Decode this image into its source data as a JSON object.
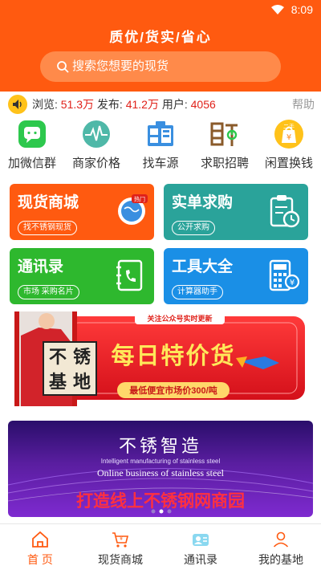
{
  "status": {
    "time": "8:09"
  },
  "header": {
    "slogan": "质优/货实/省心",
    "search_placeholder": "搜索您想要的现货"
  },
  "stats": {
    "browse_label": "浏览:",
    "browse_value": "51.3万",
    "publish_label": "发布:",
    "publish_value": "41.2万",
    "users_label": "用户:",
    "users_value": "4056",
    "help_label": "帮助"
  },
  "quick": [
    {
      "label": "加微信群",
      "icon": "wechat-icon"
    },
    {
      "label": "商家价格",
      "icon": "pulse-icon"
    },
    {
      "label": "找车源",
      "icon": "truck-pin-icon"
    },
    {
      "label": "求职招聘",
      "icon": "recruit-icon"
    },
    {
      "label": "闲置换钱",
      "icon": "secondhand-bag-icon"
    }
  ],
  "cards": [
    {
      "title": "现货商城",
      "tag": "找不锈钢现货",
      "color": "#ff5a10",
      "hot": "热门"
    },
    {
      "title": "实单求购",
      "tag": "公开求购",
      "color": "#2aa39a"
    },
    {
      "title": "通讯录",
      "tag": "市场 采购名片",
      "color": "#2eb82e"
    },
    {
      "title": "工具大全",
      "tag": "计算器助手",
      "color": "#1a8fe6"
    }
  ],
  "banner1": {
    "top_tag": "关注公众号实时更新",
    "logo_text": [
      "不",
      "锈",
      "基",
      "地"
    ],
    "headline": "每日特价货",
    "sub": "最低便宜市场价300/吨"
  },
  "banner2": {
    "title": "不锈智造",
    "en_line1": "Intelligent manufacturing of stainless steel",
    "en_line2": "Online business of stainless steel",
    "main": "打造线上不锈钢网商园"
  },
  "tabs": [
    {
      "label": "首 页",
      "icon": "home-icon",
      "active": true
    },
    {
      "label": "现货商城",
      "icon": "cart-icon",
      "active": false
    },
    {
      "label": "通讯录",
      "icon": "contacts-icon",
      "active": false
    },
    {
      "label": "我的基地",
      "icon": "user-icon",
      "active": false
    }
  ],
  "colors": {
    "brand": "#ff5a10",
    "price_red": "#e0211a"
  }
}
